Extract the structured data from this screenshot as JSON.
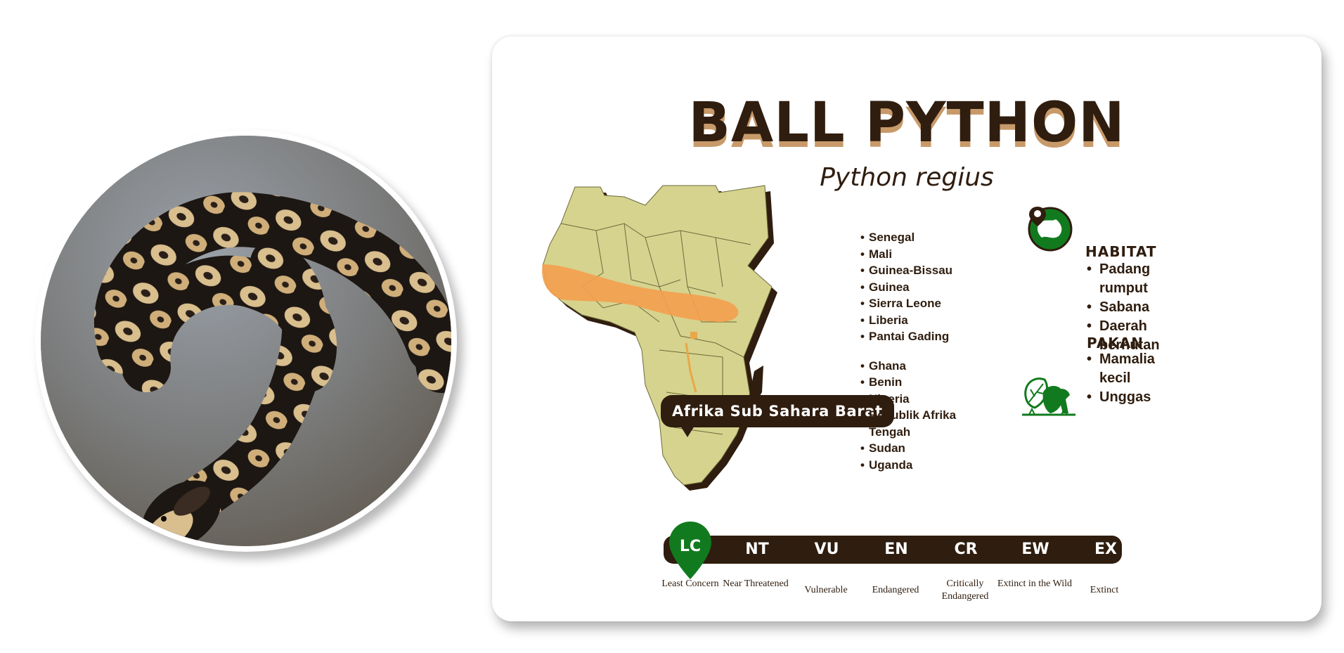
{
  "species": {
    "common_name": "BALL PYTHON",
    "scientific_name": "Python regius"
  },
  "map": {
    "region_label": "Afrika Sub Sahara Barat",
    "map_color": "#d6d38e",
    "range_color": "#f3a04f"
  },
  "countries": {
    "group1": [
      "Senegal",
      "Mali",
      "Guinea-Bissau",
      "Guinea",
      "Sierra Leone",
      "Liberia",
      "Pantai Gading"
    ],
    "group2": [
      "Ghana",
      "Benin",
      "Nigeria",
      "Republik Afrika Tengah",
      "Sudan",
      "Uganda"
    ]
  },
  "habitat": {
    "heading": "HABITAT",
    "icon": "globe-pin-icon",
    "items": [
      "Padang rumput",
      "Sabana",
      "Daerah berhutan"
    ]
  },
  "food": {
    "heading": "PAKAN",
    "icon": "leaves-animal-icon",
    "items": [
      "Mamalia kecil",
      "Unggas"
    ]
  },
  "conservation": {
    "active_code": "LC",
    "active_color": "#127a1e",
    "bar_color": "#2f1d0f",
    "statuses": [
      {
        "code": "LC",
        "name": "Least Concern"
      },
      {
        "code": "NT",
        "name": "Near Threatened"
      },
      {
        "code": "VU",
        "name": "Vulnerable"
      },
      {
        "code": "EN",
        "name": "Endangered"
      },
      {
        "code": "CR",
        "name": "Critically Endangered"
      },
      {
        "code": "EW",
        "name": "Extinct in the Wild"
      },
      {
        "code": "EX",
        "name": "Extinct"
      }
    ]
  }
}
